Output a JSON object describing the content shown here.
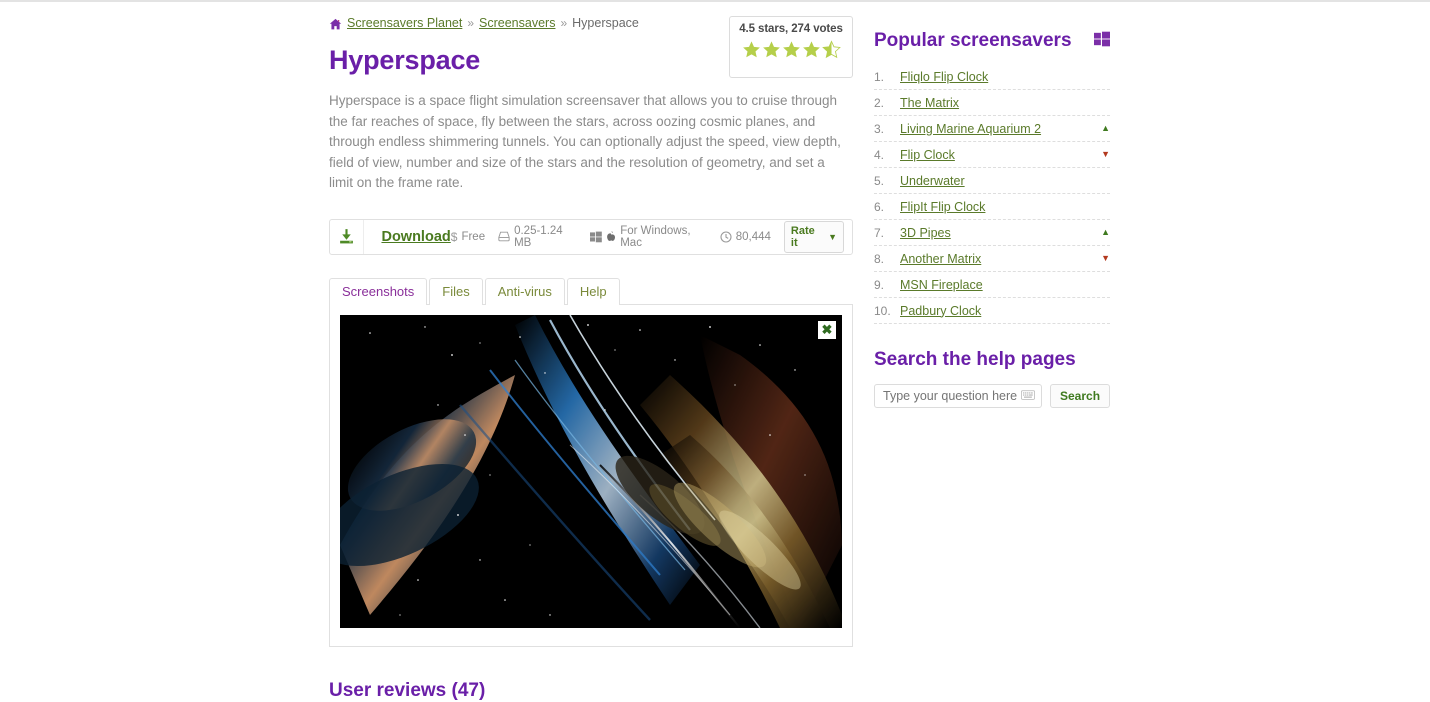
{
  "breadcrumb": {
    "home_icon": "home-icon",
    "items": [
      {
        "label": "Screensavers Planet",
        "link": true
      },
      {
        "label": "Screensavers",
        "link": true
      },
      {
        "label": "Hyperspace",
        "link": false
      }
    ],
    "separator": "»"
  },
  "page": {
    "title": "Hyperspace",
    "description": "Hyperspace is a space flight simulation screensaver that allows you to cruise through the far reaches of space, fly between the stars, across oozing cosmic planes, and through endless shimmering tunnels. You can optionally adjust the speed, view depth, field of view, number and size of the stars and the resolution of geometry, and set a limit on the frame rate."
  },
  "rating": {
    "summary": "4.5 stars, 274 votes",
    "value": 4.5,
    "max": 5,
    "star_color": "#b5cf4a"
  },
  "download": {
    "icon": "download-icon",
    "label": "Download",
    "price_icon": "$",
    "price": "Free",
    "size_icon": "disk-icon",
    "size": "0.25-1.24 MB",
    "platform_icons": [
      "windows-icon",
      "apple-icon"
    ],
    "platforms": "For Windows, Mac",
    "downloads_icon": "clock-icon",
    "downloads": "80,444",
    "rate_label": "Rate it",
    "rate_chevron": "chevron-down-icon"
  },
  "tabs": [
    {
      "label": "Screenshots",
      "active": true
    },
    {
      "label": "Files",
      "active": false
    },
    {
      "label": "Anti-virus",
      "active": false
    },
    {
      "label": "Help",
      "active": false
    }
  ],
  "screenshot": {
    "alt": "Hyperspace screensaver preview",
    "close_label": "✖"
  },
  "reviews": {
    "heading": "User reviews (47)"
  },
  "sidebar": {
    "popular": {
      "title": "Popular screensavers",
      "icon": "windows-icon",
      "items": [
        {
          "rank": "1.",
          "label": "Fliqlo Flip Clock",
          "trend": "",
          "link": true
        },
        {
          "rank": "2.",
          "label": "The Matrix",
          "trend": "",
          "link": true
        },
        {
          "rank": "3.",
          "label": "Living Marine Aquarium 2",
          "trend": "up",
          "link": true
        },
        {
          "rank": "4.",
          "label": "Flip Clock",
          "trend": "down",
          "link": true
        },
        {
          "rank": "5.",
          "label": "Underwater",
          "trend": "",
          "link": true
        },
        {
          "rank": "6.",
          "label": "FlipIt Flip Clock",
          "trend": "",
          "link": false
        },
        {
          "rank": "7.",
          "label": "3D Pipes",
          "trend": "up",
          "link": true
        },
        {
          "rank": "8.",
          "label": "Another Matrix",
          "trend": "down",
          "link": true
        },
        {
          "rank": "9.",
          "label": "MSN Fireplace",
          "trend": "",
          "link": true
        },
        {
          "rank": "10.",
          "label": "Padbury Clock",
          "trend": "",
          "link": true
        }
      ]
    },
    "search": {
      "title": "Search the help pages",
      "placeholder": "Type your question here",
      "value": "",
      "keyboard_icon": "keyboard-icon",
      "button_label": "Search"
    }
  },
  "colors": {
    "purple": "#6a1fa8",
    "green_link": "#5a7a2a",
    "star": "#b5cf4a",
    "trend_up": "#3f7a1f",
    "trend_down": "#b33a1f"
  }
}
